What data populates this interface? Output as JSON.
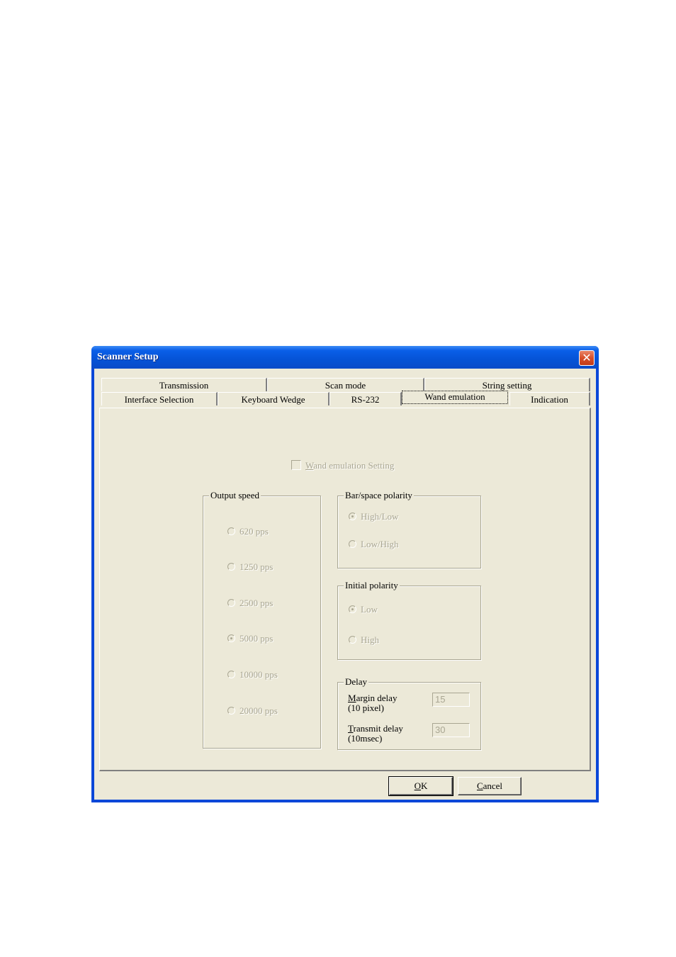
{
  "window": {
    "title": "Scanner Setup",
    "close_icon": "close-x-icon"
  },
  "tabs": {
    "row1": [
      {
        "label": "Transmission"
      },
      {
        "label": "Scan mode"
      },
      {
        "label": "String setting"
      }
    ],
    "row2": [
      {
        "label": "Interface Selection"
      },
      {
        "label": "Keyboard Wedge"
      },
      {
        "label": "RS-232"
      },
      {
        "label": "Wand emulation",
        "active": true
      },
      {
        "label": "Indication"
      }
    ]
  },
  "wand": {
    "enable_checkbox": {
      "accel": "W",
      "rest": "and emulation Setting",
      "checked": false,
      "enabled": false
    },
    "output_speed": {
      "legend": "Output speed",
      "options": [
        {
          "label": "620 pps",
          "selected": false
        },
        {
          "label": "1250 pps",
          "selected": false
        },
        {
          "label": "2500 pps",
          "selected": false
        },
        {
          "label": "5000 pps",
          "selected": true
        },
        {
          "label": "10000 pps",
          "selected": false
        },
        {
          "label": "20000 pps",
          "selected": false
        }
      ]
    },
    "bar_space_polarity": {
      "legend": "Bar/space polarity",
      "options": [
        {
          "label": "High/Low",
          "selected": true
        },
        {
          "label": "Low/High",
          "selected": false
        }
      ]
    },
    "initial_polarity": {
      "legend": "Initial polarity",
      "options": [
        {
          "label": "Low",
          "selected": true
        },
        {
          "label": "High",
          "selected": false
        }
      ]
    },
    "delay": {
      "legend": "Delay",
      "margin": {
        "accel": "M",
        "rest": "argin delay",
        "unit": "(10 pixel)",
        "value": "15"
      },
      "transmit": {
        "accel": "T",
        "rest": "ransmit delay",
        "unit": "(10msec)",
        "value": "30"
      }
    }
  },
  "buttons": {
    "ok": {
      "accel": "O",
      "rest": "K"
    },
    "cancel": {
      "accel": "C",
      "rest": "ancel"
    }
  }
}
